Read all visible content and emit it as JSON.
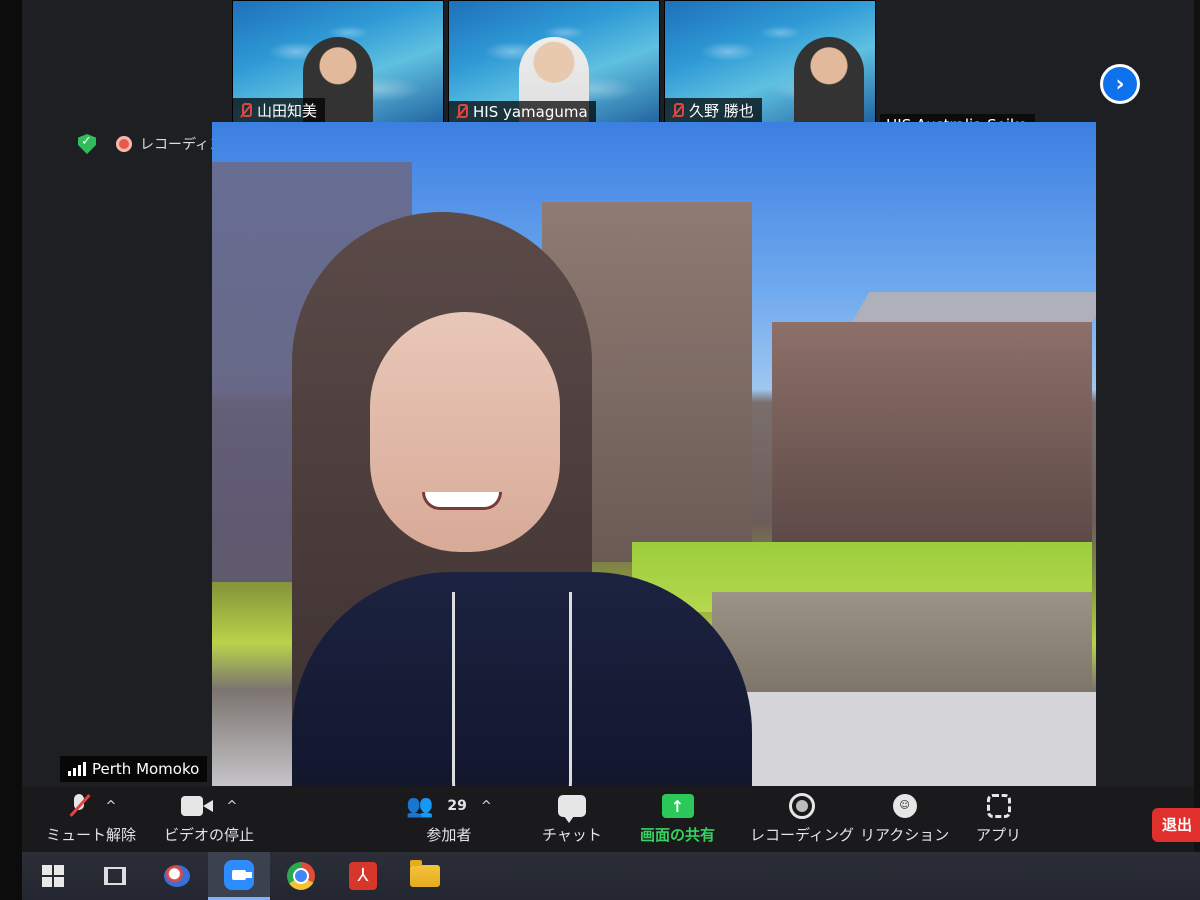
{
  "gallery": {
    "tiles": [
      {
        "name": "山田知美",
        "muted": true
      },
      {
        "name": "HIS yamaguma",
        "muted": true
      },
      {
        "name": "久野 勝也",
        "muted": true
      }
    ],
    "extra_tile_name": "HIS Australia  Seiko"
  },
  "status": {
    "recording_label": "レコーディング中"
  },
  "main_video": {
    "speaker_name": "Perth Momoko"
  },
  "toolbar": {
    "mute_label": "ミュート解除",
    "video_label": "ビデオの停止",
    "participants_label": "参加者",
    "participants_count": "29",
    "chat_label": "チャット",
    "share_label": "画面の共有",
    "record_label": "レコーディング",
    "reaction_label": "リアクション",
    "apps_label": "アプリ",
    "leave_label": "退出",
    "caret": "^"
  },
  "taskbar": {
    "items": [
      "windows-start",
      "task-view",
      "snipping-tool",
      "zoom",
      "chrome",
      "acrobat",
      "file-explorer"
    ]
  },
  "colors": {
    "accent_blue": "#0e72ed",
    "share_green": "#2cc95a",
    "leave_red": "#e0302d",
    "mute_red": "#e0463f"
  }
}
